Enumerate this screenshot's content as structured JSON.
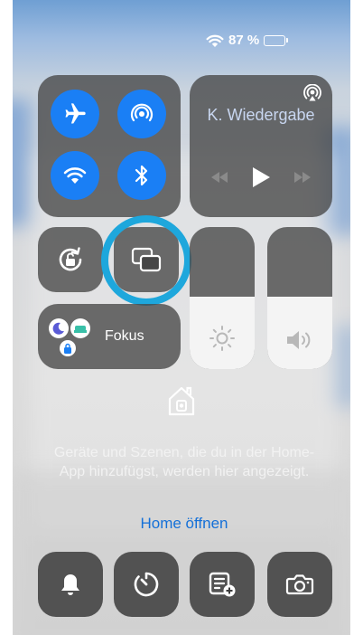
{
  "status": {
    "battery_text": "87 %",
    "battery_level": 0.87
  },
  "connectivity": {
    "airplane": {
      "icon": "airplane-icon",
      "active": false
    },
    "airdrop": {
      "icon": "airdrop-icon",
      "active": true
    },
    "wifi": {
      "icon": "wifi-icon",
      "active": true
    },
    "bluetooth": {
      "icon": "bluetooth-icon",
      "active": true
    },
    "accent": "#1a7ff5"
  },
  "media": {
    "title": "K. Wiedergabe",
    "airplay_icon": "airplay-icon",
    "controls": [
      "rewind-icon",
      "play-icon",
      "forward-icon"
    ]
  },
  "controls": {
    "rotation_lock_icon": "rotation-lock-icon",
    "screen_mirroring_icon": "screen-mirroring-icon",
    "highlight_color": "#1ea7dc"
  },
  "sliders": {
    "brightness_level": 0.51,
    "volume_level": 0.51
  },
  "focus": {
    "label": "Fokus"
  },
  "home": {
    "icon": "home-icon",
    "message": "Geräte und Szenen, die du in der Home-App hinzufügst, werden hier angezeigt.",
    "link": "Home öffnen"
  },
  "bottom_row": [
    "bell-icon",
    "timer-icon",
    "notes-add-icon",
    "camera-icon"
  ]
}
